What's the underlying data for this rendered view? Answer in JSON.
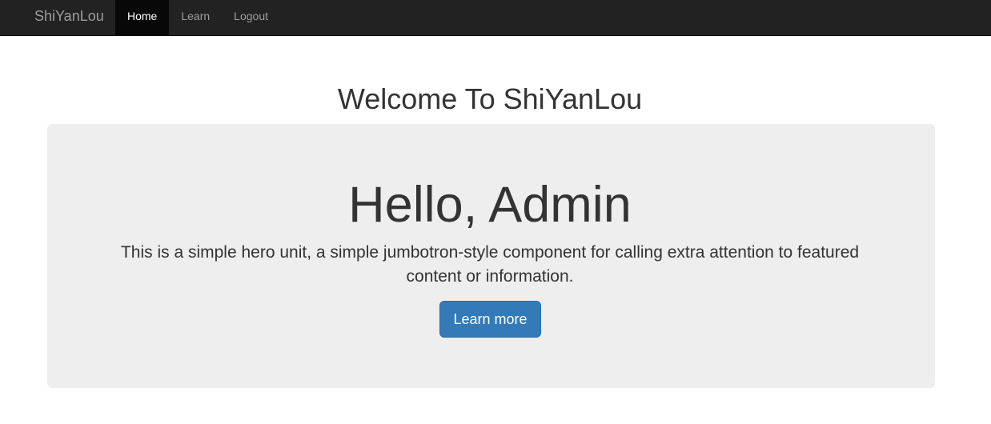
{
  "navbar": {
    "brand": "ShiYanLou",
    "items": [
      {
        "label": "Home",
        "active": true
      },
      {
        "label": "Learn",
        "active": false
      },
      {
        "label": "Logout",
        "active": false
      }
    ]
  },
  "page": {
    "welcome": "Welcome To ShiYanLou"
  },
  "hero": {
    "title": "Hello, Admin",
    "text": "This is a simple hero unit, a simple jumbotron-style component for calling extra attention to featured content or information.",
    "button_label": "Learn more"
  },
  "colors": {
    "navbar_bg": "#222222",
    "active_item_bg": "#080808",
    "jumbotron_bg": "#eeeeee",
    "button_bg": "#337ab7"
  }
}
